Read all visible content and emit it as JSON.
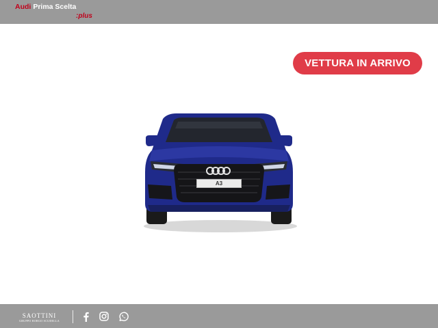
{
  "header": {
    "brand_audi": "Audi",
    "brand_prima": "Prima Scelta",
    "brand_plus": ":plus"
  },
  "badge": {
    "label": "VETTURA IN ARRIVO",
    "color": "#e03c48"
  },
  "car": {
    "plate_text": "A3",
    "body_color": "#1f2a8a"
  },
  "footer": {
    "dealer_name": "SAOTTINI",
    "dealer_sub": "GRUPPO BORGO SCUDELLA",
    "social_icons": [
      "facebook-icon",
      "instagram-icon",
      "whatsapp-icon"
    ]
  },
  "colors": {
    "bar_gray": "#9a9a9a",
    "audi_red": "#c0001a"
  }
}
